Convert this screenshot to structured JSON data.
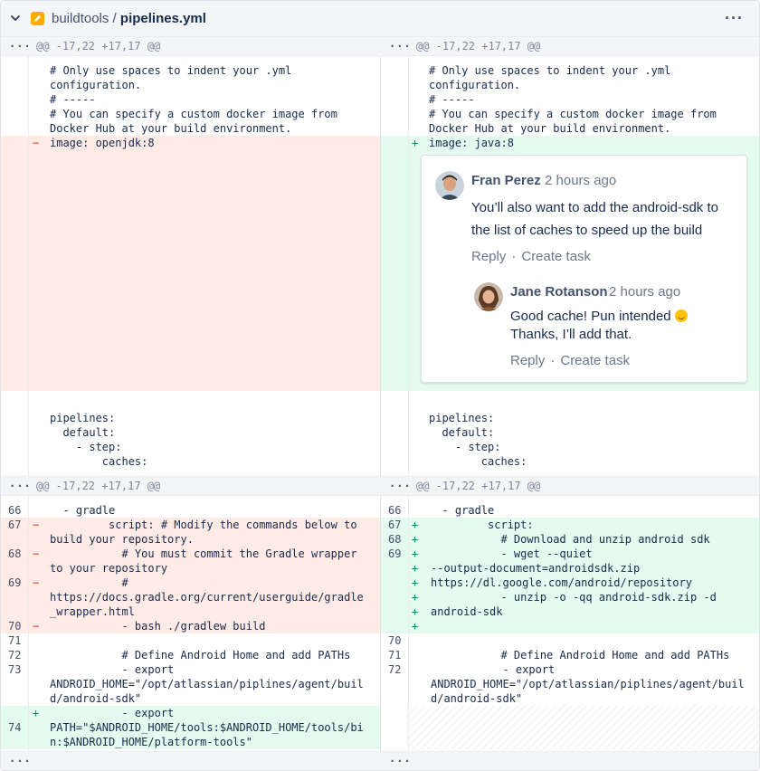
{
  "header": {
    "folder": "buildtools",
    "separator": " / ",
    "filename": "pipelines.yml",
    "more_label": "···"
  },
  "hunks": {
    "dots": "···",
    "header_text": "@@ -17,22 +17,17 @@"
  },
  "left": {
    "context1": "# Only use spaces to indent your .yml\nconfiguration.\n# -----\n# You can specify a custom docker image from\nDocker Hub at your build environment.",
    "removed_image": "image: openjdk:8",
    "context2": "pipelines:\n  default:\n    - step:\n        caches:",
    "rows": [
      {
        "num": "66",
        "mark": "",
        "text": "  - gradle"
      },
      {
        "num": "67",
        "mark": "−",
        "text": "         script: # Modify the commands below to\nbuild your repository."
      },
      {
        "num": "68",
        "mark": "−",
        "text": "           # You must commit the Gradle wrapper\nto your repository"
      },
      {
        "num": "69",
        "mark": "−",
        "text": "           #\nhttps://docs.gradle.org/current/userguide/gradle\n_wrapper.html"
      },
      {
        "num": "70",
        "mark": "−",
        "text": "           - bash ./gradlew build"
      },
      {
        "num": "71",
        "mark": "",
        "text": ""
      },
      {
        "num": "72",
        "mark": "",
        "text": "           # Define Android Home and add PATHs"
      },
      {
        "num": "73",
        "mark": "",
        "text": "           - export\nANDROID_HOME=\"/opt/atlassian/piplines/agent/buil\nd/android-sdk\""
      },
      {
        "num": "74",
        "mark": "+",
        "text": "           - export\nPATH=\"$ANDROID_HOME/tools:$ANDROID_HOME/tools/bi\nn:$ANDROID_HOME/platform-tools\""
      }
    ]
  },
  "right": {
    "context1": "# Only use spaces to indent your .yml\nconfiguration.\n# -----\n# You can specify a custom docker image from\nDocker Hub at your build environment.",
    "added_image": "image: java:8",
    "context2": "pipelines:\n  default:\n    - step:\n        caches:",
    "rows": [
      {
        "num": "66",
        "mark": "",
        "text": "  - gradle"
      },
      {
        "num": "67",
        "mark": "+",
        "text": "         script:"
      },
      {
        "num": "68",
        "mark": "+",
        "text": "           # Download and unzip android sdk"
      },
      {
        "num": "69",
        "mark": "+",
        "text": "           - wget --quiet"
      },
      {
        "num": "",
        "mark": "+",
        "text": "--output-document=androidsdk.zip"
      },
      {
        "num": "",
        "mark": "+",
        "text": "https://dl.google.com/android/repository"
      },
      {
        "num": "",
        "mark": "+",
        "text": "           - unzip -o -qq android-sdk.zip -d"
      },
      {
        "num": "",
        "mark": "+",
        "text": "android-sdk"
      },
      {
        "num": "",
        "mark": "+",
        "text": ""
      },
      {
        "num": "70",
        "mark": "",
        "text": ""
      },
      {
        "num": "71",
        "mark": "",
        "text": "           # Define Android Home and add PATHs"
      },
      {
        "num": "72",
        "mark": "",
        "text": "           - export\nANDROID_HOME=\"/opt/atlassian/piplines/agent/buil\nd/android-sdk\""
      }
    ]
  },
  "comments": [
    {
      "author": "Fran Perez",
      "time": "2 hours ago",
      "body_line1": "You’ll also want to add the android-sdk to",
      "body_line2": "the list of caches to speed up the build",
      "reply": "Reply",
      "task": "Create task"
    },
    {
      "author": "Jane Rotanson",
      "time": "2 hours ago",
      "body_line1": "Good cache! Pun intended",
      "body_line2": "Thanks, I’ll add that.",
      "reply": "Reply",
      "task": "Create task"
    }
  ],
  "colors": {
    "removed_bg": "#ffebe6",
    "added_bg": "#e3fcef",
    "removed_mark": "#de350b",
    "added_mark": "#00875a"
  },
  "icons": [
    "chevron-down-icon",
    "file-icon",
    "more-icon"
  ]
}
